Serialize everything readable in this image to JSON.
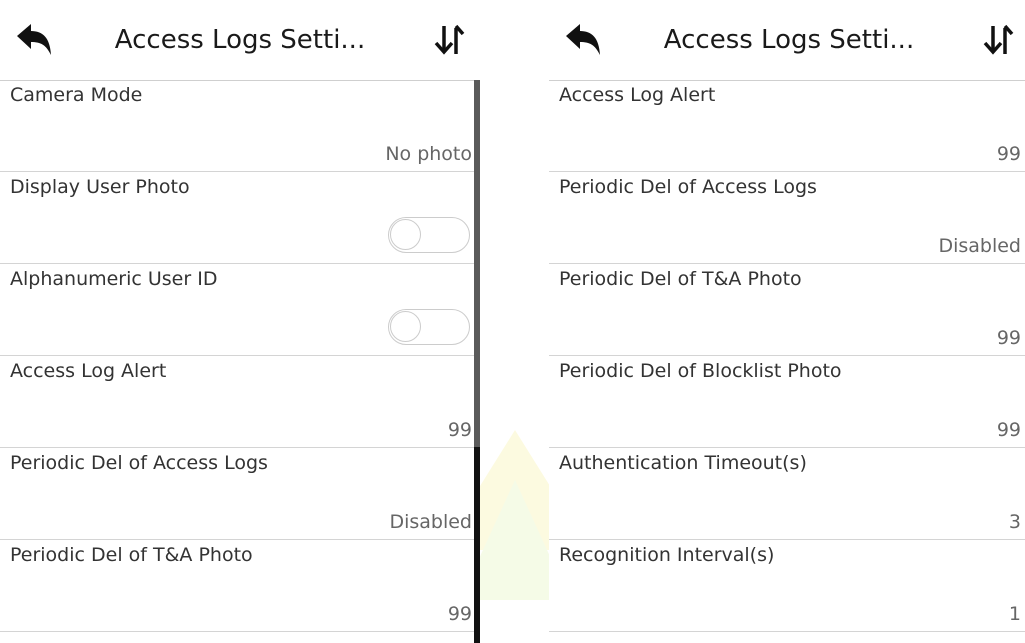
{
  "colors": {
    "text_label": "#333333",
    "text_value": "#666666",
    "divider": "#d4d4d4",
    "scrollbar": "#111111"
  },
  "left_panel": {
    "header": {
      "title": "Access Logs Setti...",
      "back_icon": "back-arrow-icon",
      "sort_icon": "sort-icon"
    },
    "rows": [
      {
        "label": "Camera Mode",
        "value": "No photo"
      },
      {
        "label": "Display User Photo",
        "toggle": "off"
      },
      {
        "label": "Alphanumeric User ID",
        "toggle": "off"
      },
      {
        "label": "Access Log Alert",
        "value": "99"
      },
      {
        "label": "Periodic Del of Access Logs",
        "value": "Disabled"
      },
      {
        "label": "Periodic Del of T&A Photo",
        "value": "99"
      }
    ]
  },
  "right_panel": {
    "header": {
      "title": "Access Logs Setti...",
      "back_icon": "back-arrow-icon",
      "sort_icon": "sort-icon"
    },
    "rows": [
      {
        "label": "Access Log Alert",
        "value": "99"
      },
      {
        "label": "Periodic Del of Access Logs",
        "value": "Disabled"
      },
      {
        "label": "Periodic Del of T&A Photo",
        "value": "99"
      },
      {
        "label": "Periodic Del of Blocklist Photo",
        "value": "99"
      },
      {
        "label": "Authentication Timeout(s)",
        "value": "3"
      },
      {
        "label": "Recognition Interval(s)",
        "value": "1"
      }
    ]
  }
}
